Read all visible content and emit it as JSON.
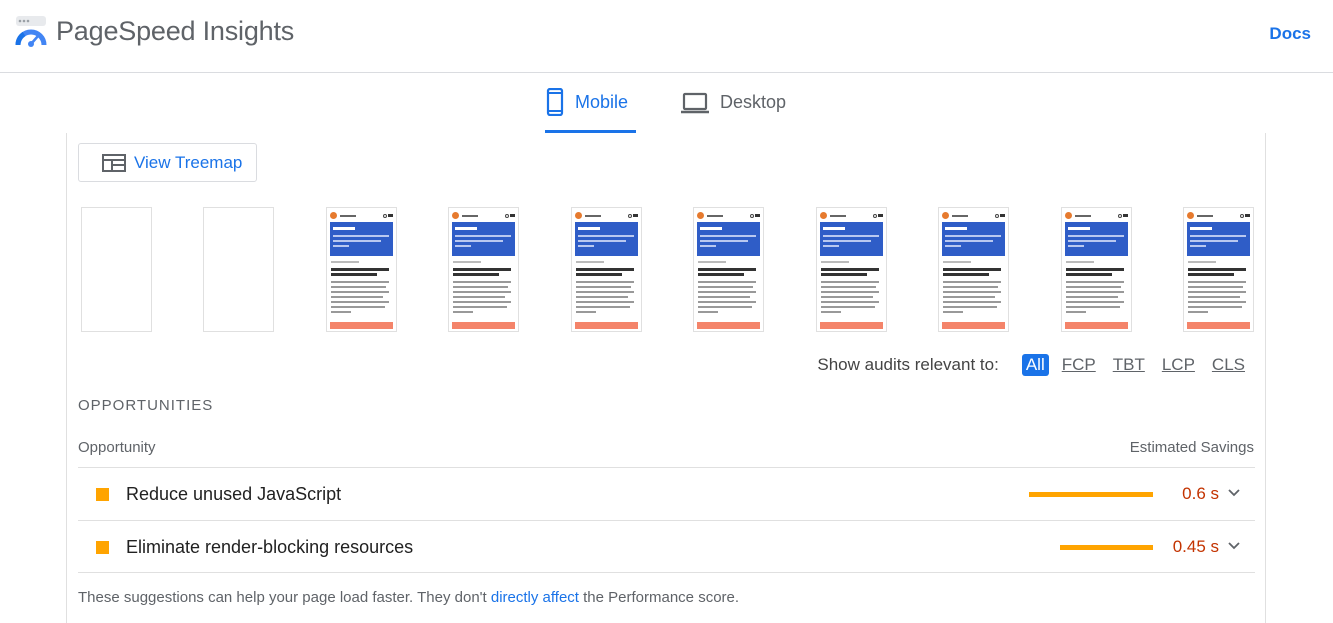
{
  "header": {
    "brand": "PageSpeed Insights",
    "docs_label": "Docs"
  },
  "tabs": [
    {
      "label": "Mobile",
      "icon": "phone-icon",
      "active": true
    },
    {
      "label": "Desktop",
      "icon": "laptop-icon",
      "active": false
    }
  ],
  "treemap": {
    "label": "View Treemap",
    "icon": "treemap-icon"
  },
  "filmstrip": {
    "frames": 10,
    "blank_frames": 2
  },
  "filter": {
    "label": "Show audits relevant to:",
    "options": [
      "All",
      "FCP",
      "TBT",
      "LCP",
      "CLS"
    ],
    "active": "All"
  },
  "opportunities": {
    "section_title": "OPPORTUNITIES",
    "col_left": "Opportunity",
    "col_right": "Estimated Savings",
    "items": [
      {
        "title": "Reduce unused JavaScript",
        "savings": "0.6 s",
        "bar_fraction": 1.0
      },
      {
        "title": "Eliminate render-blocking resources",
        "savings": "0.45 s",
        "bar_fraction": 0.75
      }
    ]
  },
  "note": {
    "before": "These suggestions can help your page load faster. They don't ",
    "link": "directly affect",
    "after": " the Performance score."
  },
  "colors": {
    "accent": "#1a73e8",
    "warning": "#ffa400",
    "savings_text": "#c33300"
  }
}
